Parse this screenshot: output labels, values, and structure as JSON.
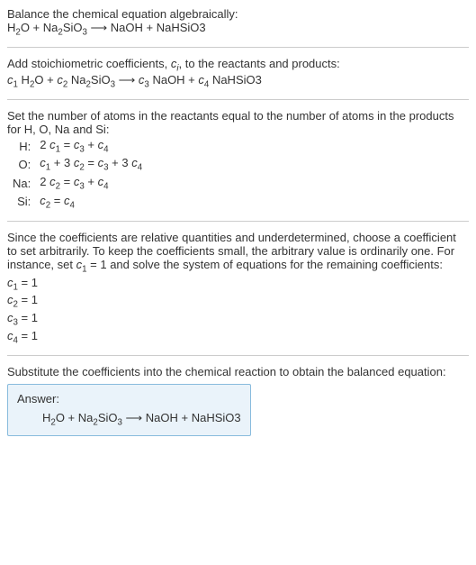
{
  "intro": {
    "line1": "Balance the chemical equation algebraically:",
    "eq_lhs1": "H",
    "eq_lhs1_sub": "2",
    "eq_lhs2": "O + Na",
    "eq_lhs2_sub": "2",
    "eq_lhs3": "SiO",
    "eq_lhs3_sub": "3",
    "arrow": " ⟶ ",
    "eq_rhs": "NaOH + NaHSiO3"
  },
  "step1": {
    "text_a": "Add stoichiometric coefficients, ",
    "ci": "c",
    "ci_sub": "i",
    "text_b": ", to the reactants and products:",
    "c1": "c",
    "c1_sub": "1",
    "sp1": " H",
    "sp1_sub": "2",
    "sp2": "O + ",
    "c2": "c",
    "c2_sub": "2",
    "sp3": " Na",
    "sp3_sub": "2",
    "sp4": "SiO",
    "sp4_sub": "3",
    "arrow": " ⟶ ",
    "c3": "c",
    "c3_sub": "3",
    "sp5": " NaOH + ",
    "c4": "c",
    "c4_sub": "4",
    "sp6": " NaHSiO3"
  },
  "step2": {
    "text": "Set the number of atoms in the reactants equal to the number of atoms in the products for H, O, Na and Si:",
    "rows": [
      {
        "el": "H:",
        "a": "2 ",
        "c1": "c",
        "c1s": "1",
        "mid": " = ",
        "c3": "c",
        "c3s": "3",
        "plus": " + ",
        "c4": "c",
        "c4s": "4"
      },
      {
        "el": "O:",
        "a": "",
        "c1": "c",
        "c1s": "1",
        "mid": " + 3 ",
        "c2": "c",
        "c2s": "2",
        "eq": " = ",
        "c3": "c",
        "c3s": "3",
        "plus": " + 3 ",
        "c4": "c",
        "c4s": "4"
      },
      {
        "el": "Na:",
        "a": "2 ",
        "c2": "c",
        "c2s": "2",
        "eq": " = ",
        "c3": "c",
        "c3s": "3",
        "plus": " + ",
        "c4": "c",
        "c4s": "4"
      },
      {
        "el": "Si:",
        "c2": "c",
        "c2s": "2",
        "eq": " = ",
        "c4": "c",
        "c4s": "4"
      }
    ]
  },
  "step3": {
    "text_a": "Since the coefficients are relative quantities and underdetermined, choose a coefficient to set arbitrarily. To keep the coefficients small, the arbitrary value is ordinarily one. For instance, set ",
    "c1": "c",
    "c1_sub": "1",
    "text_b": " = 1 and solve the system of equations for the remaining coefficients:",
    "lines": [
      {
        "c": "c",
        "cs": "1",
        "v": " = 1"
      },
      {
        "c": "c",
        "cs": "2",
        "v": " = 1"
      },
      {
        "c": "c",
        "cs": "3",
        "v": " = 1"
      },
      {
        "c": "c",
        "cs": "4",
        "v": " = 1"
      }
    ]
  },
  "step4": {
    "text": "Substitute the coefficients into the chemical reaction to obtain the balanced equation:",
    "answer_label": "Answer:",
    "eq_lhs1": "H",
    "eq_lhs1_sub": "2",
    "eq_lhs2": "O + Na",
    "eq_lhs2_sub": "2",
    "eq_lhs3": "SiO",
    "eq_lhs3_sub": "3",
    "arrow": " ⟶ ",
    "eq_rhs": "NaOH + NaHSiO3"
  }
}
